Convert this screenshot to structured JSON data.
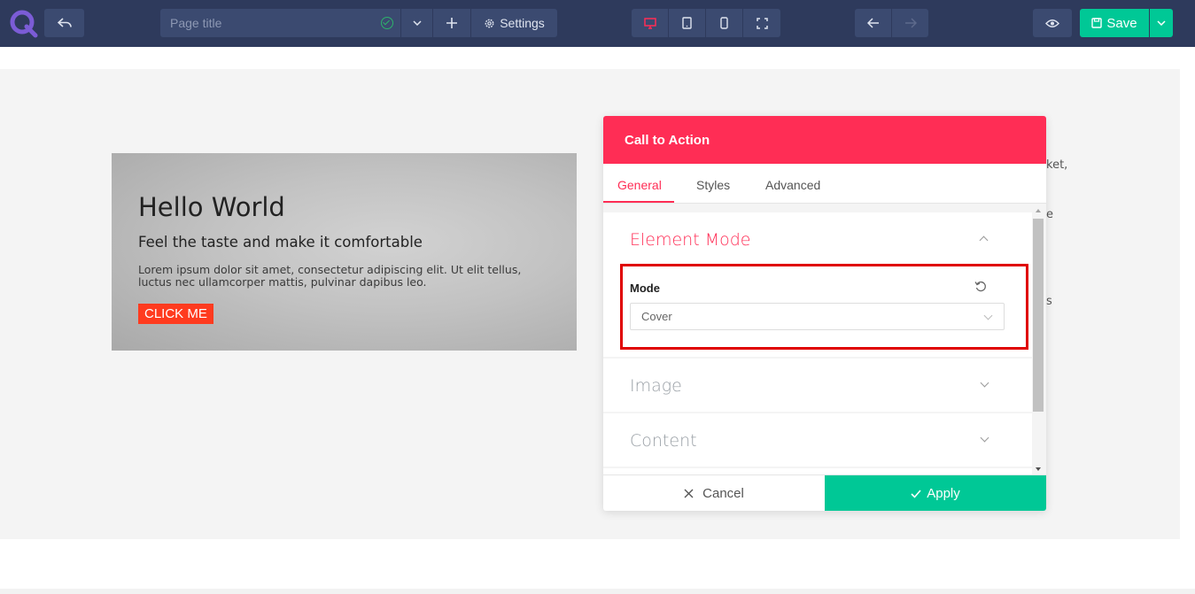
{
  "toolbar": {
    "title_placeholder": "Page title",
    "settings_label": "Settings",
    "save_label": "Save",
    "colors": {
      "bar": "#2e3a5c",
      "button": "#3b4a70",
      "accent": "#ff2d55",
      "save": "#00c896"
    },
    "icons": [
      "logo-q-icon",
      "undo-icon",
      "check-circle-icon",
      "chevron-down-icon",
      "plus-icon",
      "gear-icon",
      "desktop-icon",
      "tablet-icon",
      "mobile-icon",
      "fullscreen-icon",
      "arrow-left-icon",
      "arrow-right-icon",
      "eye-icon",
      "save-disk-icon"
    ]
  },
  "canvas": {
    "cta": {
      "heading": "Hello World",
      "subheading": "Feel the taste and make it comfortable",
      "text": "Lorem ipsum dolor sit amet, consectetur adipiscing elit. Ut elit tellus, luctus nec ullamcorper mattis, pulvinar dapibus leo.",
      "button": "CLICK ME"
    },
    "peek": [
      "ket,",
      "e",
      "s"
    ]
  },
  "panel": {
    "title": "Call to Action",
    "tabs": [
      {
        "label": "General",
        "active": true
      },
      {
        "label": "Styles",
        "active": false
      },
      {
        "label": "Advanced",
        "active": false
      }
    ],
    "sections": [
      {
        "title": "Element Mode",
        "expanded": true
      },
      {
        "title": "Image",
        "expanded": false
      },
      {
        "title": "Content",
        "expanded": false
      }
    ],
    "mode": {
      "label": "Mode",
      "value": "Cover"
    },
    "cancel_label": "Cancel",
    "apply_label": "Apply"
  }
}
